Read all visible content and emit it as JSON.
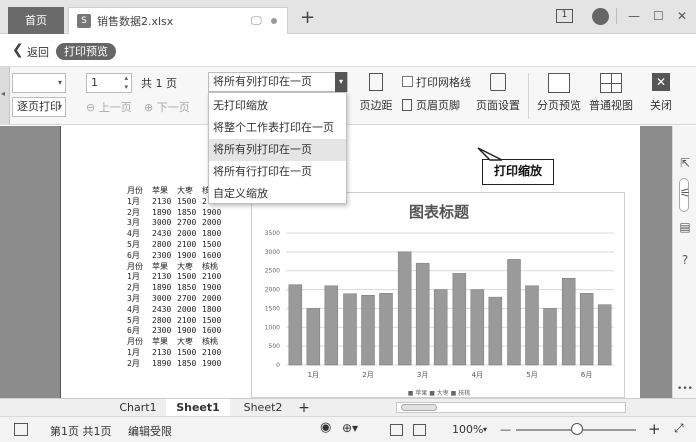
{
  "titlebar": {
    "home_tab": "首页",
    "file_tab": "销售数据2.xlsx",
    "file_icon": "S",
    "add_tab": "+",
    "page_indicator": "1",
    "win_min": "—",
    "win_max": "☐",
    "win_close": "✕"
  },
  "backbar": {
    "back_label": "返回",
    "mode_badge": "打印预览"
  },
  "ribbon": {
    "printer_value": "",
    "order_value": "逐页打印",
    "page_value": "1",
    "total_pages": "共 1 页",
    "prev_page": "上一页",
    "next_page": "下一页",
    "scale_value": "将所有列打印在一页",
    "print_gridlines": "打印网格线",
    "margins": "页边距",
    "header_footer": "页眉页脚",
    "page_setup": "页面设置",
    "page_break_preview": "分页预览",
    "normal_view": "普通视图",
    "close": "关闭"
  },
  "dropdown": {
    "items": [
      {
        "label": "无打印缩放"
      },
      {
        "label": "将整个工作表打印在一页"
      },
      {
        "label": "将所有列打印在一页"
      },
      {
        "label": "将所有行打印在一页"
      },
      {
        "label": "自定义缩放"
      }
    ],
    "selected_index": 2
  },
  "callout": {
    "text": "打印缩放"
  },
  "table": {
    "rows": [
      [
        "月份",
        "苹果",
        "大枣",
        "核桃"
      ],
      [
        "1月",
        "2130",
        "1500",
        "2100"
      ],
      [
        "2月",
        "1890",
        "1850",
        "1900"
      ],
      [
        "3月",
        "3000",
        "2700",
        "2000"
      ],
      [
        "4月",
        "2430",
        "2000",
        "1800"
      ],
      [
        "5月",
        "2800",
        "2100",
        "1500"
      ],
      [
        "6月",
        "2300",
        "1900",
        "1600"
      ],
      [
        "月份",
        "苹果",
        "大枣",
        "核桃"
      ],
      [
        "1月",
        "2130",
        "1500",
        "2100"
      ],
      [
        "2月",
        "1890",
        "1850",
        "1900"
      ],
      [
        "3月",
        "3000",
        "2700",
        "2000"
      ],
      [
        "4月",
        "2430",
        "2000",
        "1800"
      ],
      [
        "5月",
        "2800",
        "2100",
        "1500"
      ],
      [
        "6月",
        "2300",
        "1900",
        "1600"
      ],
      [
        "月份",
        "苹果",
        "大枣",
        "核桃"
      ],
      [
        "1月",
        "2130",
        "1500",
        "2100"
      ],
      [
        "2月",
        "1890",
        "1850",
        "1900"
      ]
    ]
  },
  "chart_data": {
    "type": "bar",
    "title": "图表标题",
    "categories": [
      "1月",
      "2月",
      "3月",
      "4月",
      "5月",
      "6月"
    ],
    "series": [
      {
        "name": "苹果",
        "values": [
          2130,
          1890,
          3000,
          2430,
          2800,
          2300
        ]
      },
      {
        "name": "大枣",
        "values": [
          1500,
          1850,
          2700,
          2000,
          2100,
          1900
        ]
      },
      {
        "name": "核桃",
        "values": [
          2100,
          1900,
          2000,
          1800,
          1500,
          1600
        ]
      }
    ],
    "ylim": [
      0,
      3500
    ],
    "yticks": [
      0,
      500,
      1000,
      1500,
      2000,
      2500,
      3000,
      3500
    ],
    "grid": true,
    "legend_position": "bottom",
    "legend_text": "■ 苹果 ■ 大枣 ■ 核桃",
    "bar_color": "#9a9a9a"
  },
  "sheets": {
    "tabs": [
      "Chart1",
      "Sheet1",
      "Sheet2"
    ],
    "active": "Sheet1",
    "add": "+"
  },
  "status": {
    "page_info": "第1页 共1页",
    "edit_state": "编辑受限",
    "zoom": "100%",
    "zoom_minus": "—",
    "zoom_plus": "+"
  }
}
